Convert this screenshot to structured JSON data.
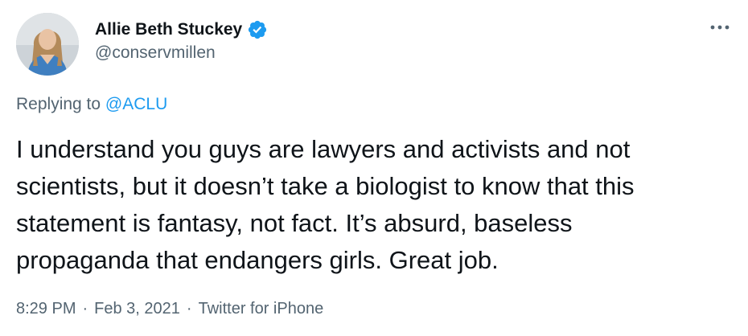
{
  "author": {
    "display_name": "Allie Beth Stuckey",
    "handle": "@conservmillen",
    "verified": true
  },
  "icons": {
    "avatar": "profile-photo",
    "verified": "verified-badge-icon",
    "more": "more-options-icon"
  },
  "colors": {
    "accent": "#1d9bf0",
    "text_primary": "#0f1419",
    "text_secondary": "#536471"
  },
  "reply": {
    "prefix": "Replying to ",
    "mention": "@ACLU"
  },
  "tweet": {
    "lines": [
      "I understand you guys are lawyers and activists and not",
      "scientists, but it doesn’t take a biologist to know that this",
      "statement is fantasy, not fact. It’s absurd, baseless",
      "propaganda that endangers girls. Great job."
    ]
  },
  "meta": {
    "time": "8:29 PM",
    "separator": "·",
    "date": "Feb 3, 2021",
    "source": "Twitter for iPhone"
  }
}
